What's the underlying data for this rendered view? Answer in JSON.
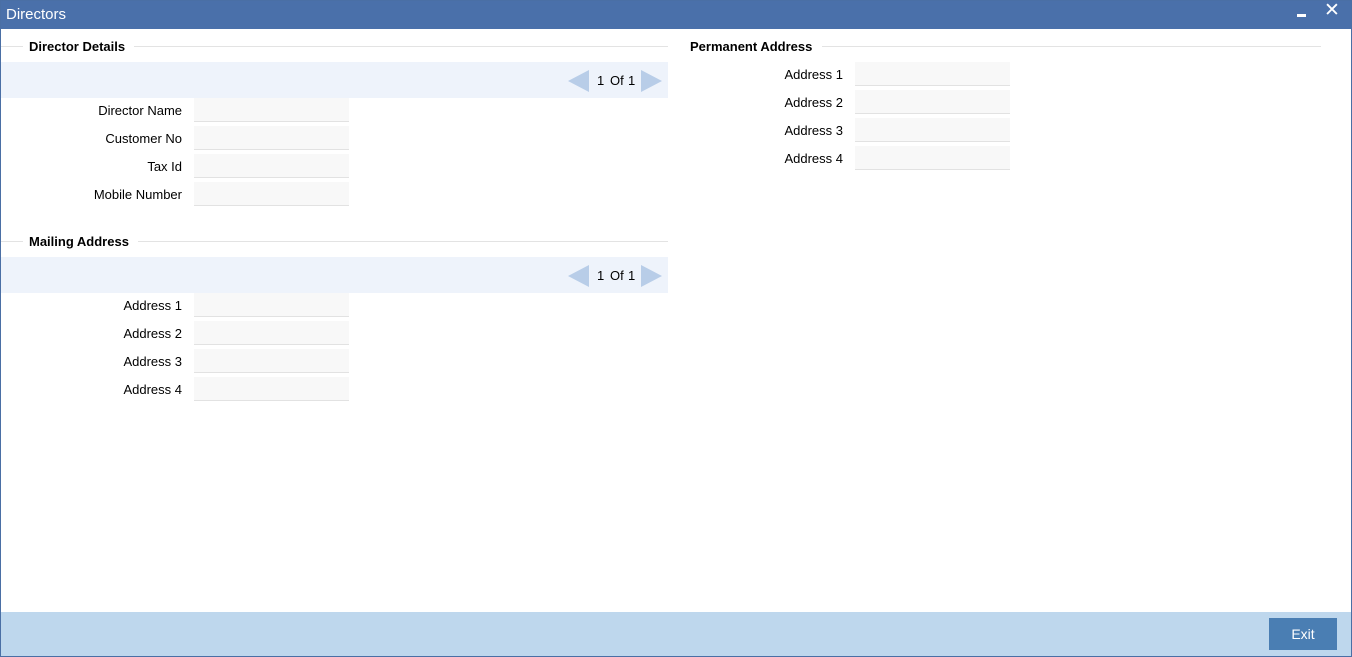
{
  "window": {
    "title": "Directors"
  },
  "director_details": {
    "title": "Director Details",
    "pager": {
      "current": "1",
      "of_label": "Of",
      "total": "1"
    },
    "fields": [
      {
        "label": "Director Name",
        "value": ""
      },
      {
        "label": "Customer No",
        "value": ""
      },
      {
        "label": "Tax Id",
        "value": ""
      },
      {
        "label": "Mobile Number",
        "value": ""
      }
    ]
  },
  "mailing_address": {
    "title": "Mailing Address",
    "pager": {
      "current": "1",
      "of_label": "Of",
      "total": "1"
    },
    "fields": [
      {
        "label": "Address 1",
        "value": ""
      },
      {
        "label": "Address 2",
        "value": ""
      },
      {
        "label": "Address 3",
        "value": ""
      },
      {
        "label": "Address 4",
        "value": ""
      }
    ]
  },
  "permanent_address": {
    "title": "Permanent Address",
    "fields": [
      {
        "label": "Address 1",
        "value": ""
      },
      {
        "label": "Address 2",
        "value": ""
      },
      {
        "label": "Address 3",
        "value": ""
      },
      {
        "label": "Address 4",
        "value": ""
      }
    ]
  },
  "footer": {
    "exit_label": "Exit"
  },
  "colors": {
    "titlebar": "#4a70aa",
    "pager_bar": "#eef3fb",
    "footer": "#bed7ed",
    "exit_button": "#4a7eb3"
  }
}
